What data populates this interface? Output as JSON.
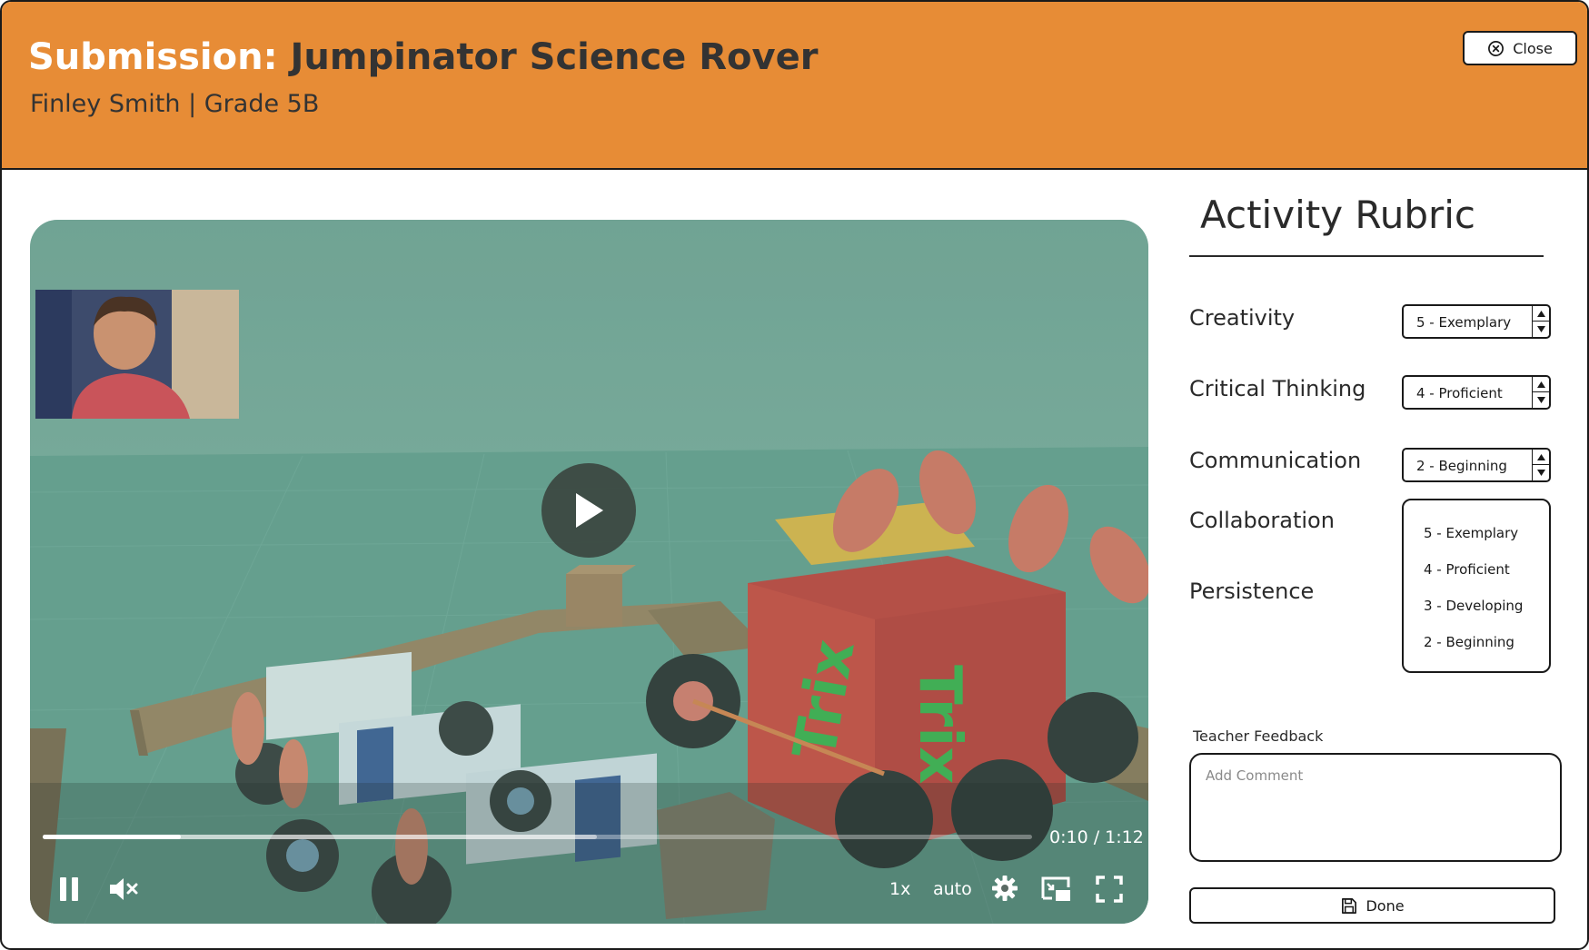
{
  "header": {
    "title_prefix": "Submission:",
    "title_name": "Jumpinator Science Rover",
    "student": "Finley Smith | Grade 5B",
    "close_label": "Close"
  },
  "video": {
    "progress_fraction": 0.14,
    "buffered_fraction": 0.56,
    "time": "0:10 / 1:12",
    "speed": "1x",
    "quality": "auto",
    "icons": [
      "play-icon",
      "pause-icon",
      "mute-icon",
      "gear-icon",
      "picture-in-picture-icon",
      "fullscreen-icon"
    ]
  },
  "rubric": {
    "title": "Activity Rubric",
    "criteria": [
      {
        "label": "Creativity",
        "value": "5 - Exemplary"
      },
      {
        "label": "Critical Thinking",
        "value": "4 - Proficient"
      },
      {
        "label": "Communication",
        "value": "2 - Beginning"
      },
      {
        "label": "Collaboration",
        "value": ""
      },
      {
        "label": "Persistence",
        "value": ""
      }
    ],
    "dropdown_options": [
      "5 - Exemplary",
      "4 - Proficient",
      "3 - Developing",
      "2 - Beginning"
    ]
  },
  "feedback": {
    "label": "Teacher Feedback",
    "placeholder": "Add Comment",
    "value": ""
  },
  "done_label": "Done",
  "colors": {
    "header_bg": "#e78c36",
    "border": "#1a1a1a",
    "text": "#2a2a2a"
  }
}
